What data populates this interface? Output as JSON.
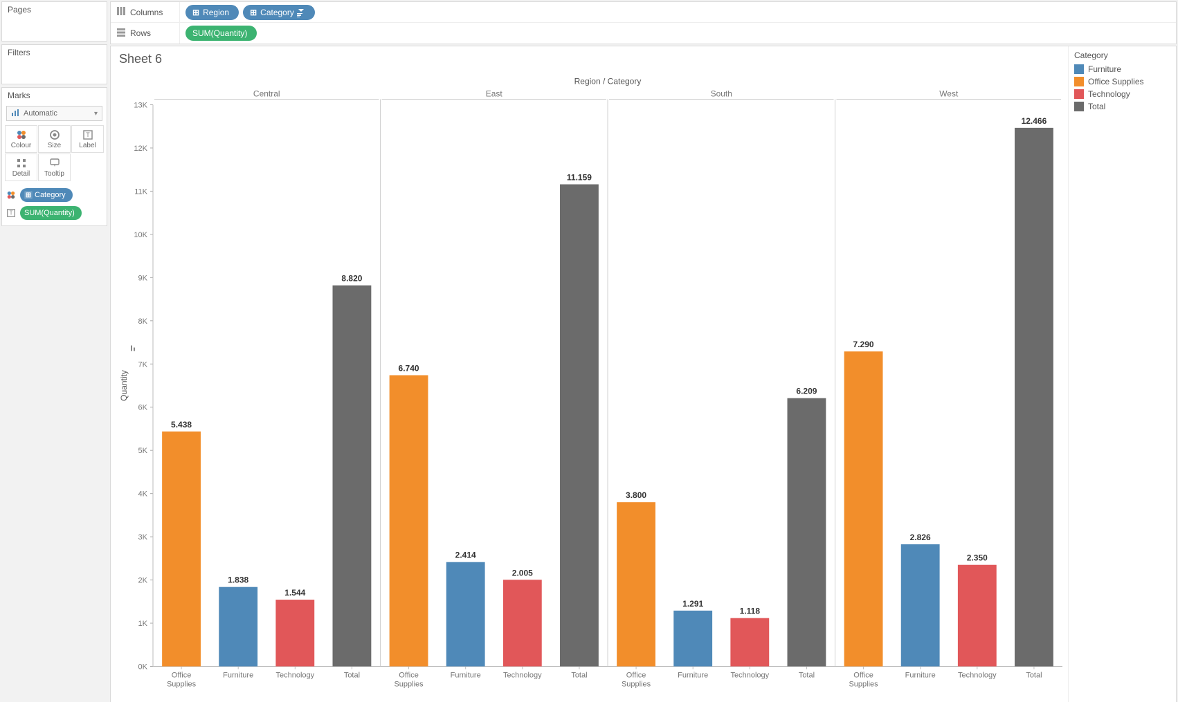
{
  "panels": {
    "pages_title": "Pages",
    "filters_title": "Filters",
    "marks_title": "Marks"
  },
  "marks": {
    "dropdown": {
      "icon_name": "bar-chart-icon",
      "label": "Automatic"
    },
    "cells": {
      "colour": "Colour",
      "size": "Size",
      "label": "Label",
      "detail": "Detail",
      "tooltip": "Tooltip"
    },
    "pills": {
      "category": "Category",
      "sum_quantity": "SUM(Quantity)"
    }
  },
  "shelves": {
    "columns_label": "Columns",
    "rows_label": "Rows",
    "columns_pills": {
      "region": "Region",
      "category": "Category"
    },
    "rows_pills": {
      "sum_quantity": "SUM(Quantity)"
    }
  },
  "viz": {
    "sheet_title": "Sheet 6",
    "col_header_line1": "Region / Category",
    "y_axis_label": "Quantity"
  },
  "legend": {
    "title": "Category",
    "items": [
      {
        "label": "Furniture",
        "color": "#4f89b8"
      },
      {
        "label": "Office Supplies",
        "color": "#f28e2b"
      },
      {
        "label": "Technology",
        "color": "#e15759"
      },
      {
        "label": "Total",
        "color": "#6b6b6b"
      }
    ]
  },
  "chart_data": {
    "type": "bar",
    "title": "Sheet 6",
    "xlabel": "Region / Category",
    "ylabel": "Quantity",
    "ylim": [
      0,
      13000
    ],
    "yticks": [
      0,
      1000,
      2000,
      3000,
      4000,
      5000,
      6000,
      7000,
      8000,
      9000,
      10000,
      11000,
      12000,
      13000
    ],
    "ytick_labels": [
      "0K",
      "1K",
      "2K",
      "3K",
      "4K",
      "5K",
      "6K",
      "7K",
      "8K",
      "9K",
      "10K",
      "11K",
      "12K",
      "13K"
    ],
    "regions": [
      "Central",
      "East",
      "South",
      "West"
    ],
    "categories": [
      "Office Supplies",
      "Furniture",
      "Technology",
      "Total"
    ],
    "category_label_lines": [
      [
        "Office",
        "Supplies"
      ],
      [
        "Furniture"
      ],
      [
        "Technology"
      ],
      [
        "Total"
      ]
    ],
    "series_colors": {
      "Furniture": "#4f89b8",
      "Office Supplies": "#f28e2b",
      "Technology": "#e15759",
      "Total": "#6b6b6b"
    },
    "bars": [
      {
        "region": "Central",
        "category": "Office Supplies",
        "value": 5438,
        "label": "5.438"
      },
      {
        "region": "Central",
        "category": "Furniture",
        "value": 1838,
        "label": "1.838"
      },
      {
        "region": "Central",
        "category": "Technology",
        "value": 1544,
        "label": "1.544"
      },
      {
        "region": "Central",
        "category": "Total",
        "value": 8820,
        "label": "8.820"
      },
      {
        "region": "East",
        "category": "Office Supplies",
        "value": 6740,
        "label": "6.740"
      },
      {
        "region": "East",
        "category": "Furniture",
        "value": 2414,
        "label": "2.414"
      },
      {
        "region": "East",
        "category": "Technology",
        "value": 2005,
        "label": "2.005"
      },
      {
        "region": "East",
        "category": "Total",
        "value": 11159,
        "label": "11.159"
      },
      {
        "region": "South",
        "category": "Office Supplies",
        "value": 3800,
        "label": "3.800"
      },
      {
        "region": "South",
        "category": "Furniture",
        "value": 1291,
        "label": "1.291"
      },
      {
        "region": "South",
        "category": "Technology",
        "value": 1118,
        "label": "1.118"
      },
      {
        "region": "South",
        "category": "Total",
        "value": 6209,
        "label": "6.209"
      },
      {
        "region": "West",
        "category": "Office Supplies",
        "value": 7290,
        "label": "7.290"
      },
      {
        "region": "West",
        "category": "Furniture",
        "value": 2826,
        "label": "2.826"
      },
      {
        "region": "West",
        "category": "Technology",
        "value": 2350,
        "label": "2.350"
      },
      {
        "region": "West",
        "category": "Total",
        "value": 12466,
        "label": "12.466"
      }
    ]
  }
}
